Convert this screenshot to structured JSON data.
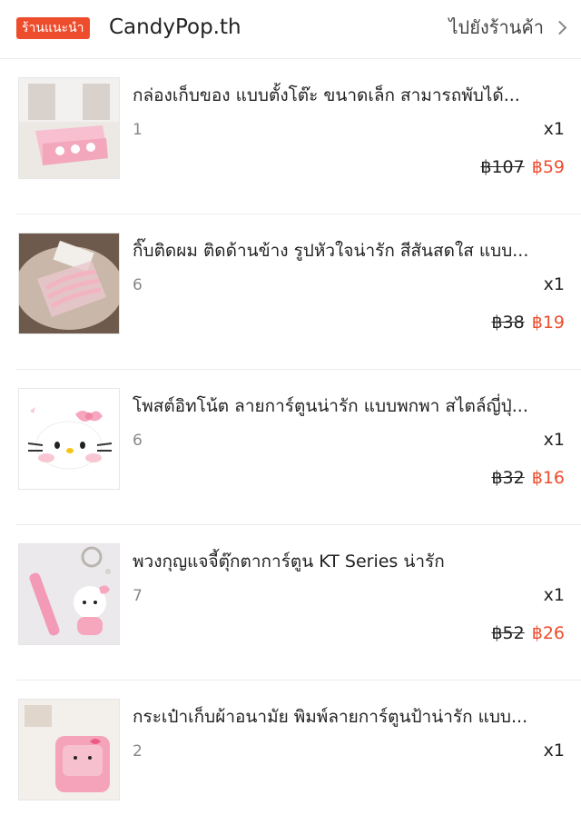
{
  "header": {
    "badge": "ร้านแนะนำ",
    "shop_name": "CandyPop.th",
    "go_shop": "ไปยังร้านค้า"
  },
  "colors": {
    "accent": "#ee4d2d"
  },
  "items": [
    {
      "title": "กล่องเก็บของ แบบตั้งโต๊ะ ขนาดเล็ก สามารถพับได้...",
      "variant": "1",
      "qty": "x1",
      "old_price": "฿107",
      "price": "฿59"
    },
    {
      "title": "กิ๊บติดผม ติดด้านข้าง รูปหัวใจน่ารัก สีสันสดใส แบบ...",
      "variant": "6",
      "qty": "x1",
      "old_price": "฿38",
      "price": "฿19"
    },
    {
      "title": "โพสต์อิทโน้ต ลายการ์ตูนน่ารัก แบบพกพา สไตล์ญี่ปุ่...",
      "variant": "6",
      "qty": "x1",
      "old_price": "฿32",
      "price": "฿16"
    },
    {
      "title": "พวงกุญแจจี้ตุ๊กตาการ์ตูน KT Series น่ารัก",
      "variant": "7",
      "qty": "x1",
      "old_price": "฿52",
      "price": "฿26"
    },
    {
      "title": "กระเป๋าเก็บผ้าอนามัย พิมพ์ลายการ์ตูนป้าน่ารัก แบบ...",
      "variant": "2",
      "qty": "x1",
      "old_price": "",
      "price": ""
    }
  ]
}
